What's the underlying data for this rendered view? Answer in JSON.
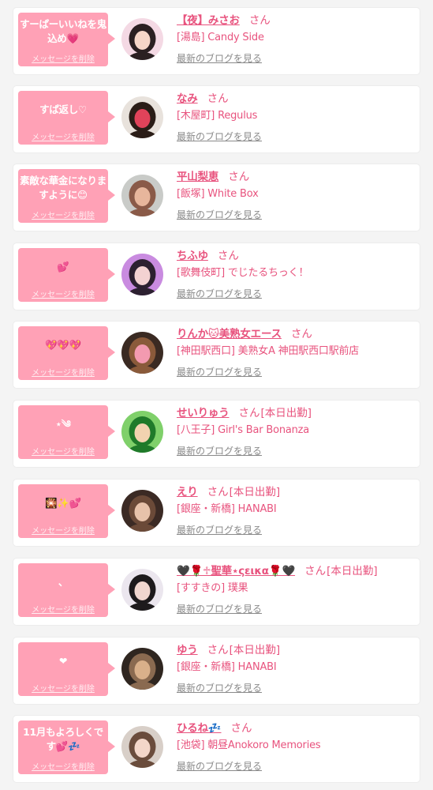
{
  "cards": [
    {
      "message": "すーぱーいいねを鬼込め💗",
      "delete_label": "メッセージを削除",
      "name": "【夜】みさお",
      "san": "さん",
      "status": "",
      "shop": "[湯島] Candy Side",
      "blog_link": "最新のブログを見る",
      "avatar_colors": [
        "#f4d9e4",
        "#2b2022",
        "#f6d6c8"
      ]
    },
    {
      "message": "すぱ返し♡",
      "delete_label": "メッセージを削除",
      "name": "なみ",
      "san": "さん",
      "status": "",
      "shop": "[木屋町] Regulus",
      "blog_link": "最新のブログを見る",
      "avatar_colors": [
        "#e8e2dc",
        "#2a1d17",
        "#e0435a"
      ]
    },
    {
      "message": "素敵な華金になりますように😊",
      "delete_label": "メッセージを削除",
      "name": "平山梨恵",
      "san": "さん",
      "status": "",
      "shop": "[飯塚] White Box",
      "blog_link": "最新のブログを見る",
      "avatar_colors": [
        "#c9cbc8",
        "#8a5a48",
        "#e7b69c"
      ]
    },
    {
      "message": "💕",
      "delete_label": "メッセージを削除",
      "name": "ちふゆ",
      "san": "さん",
      "status": "",
      "shop": "[歌舞伎町] でじたるちっく！",
      "blog_link": "最新のブログを見る",
      "avatar_colors": [
        "#c98be0",
        "#2c2030",
        "#f3d2d2"
      ]
    },
    {
      "message": "💖💖💖",
      "delete_label": "メッセージを削除",
      "name": "りんか🐱美熟女エース",
      "san": "さん",
      "status": "",
      "shop": "[神田駅西口] 美熟女A 神田駅西口駅前店",
      "blog_link": "最新のブログを見る",
      "avatar_colors": [
        "#3a2a22",
        "#8a5a3a",
        "#f39ab0"
      ]
    },
    {
      "message": "⋆༄",
      "delete_label": "メッセージを削除",
      "name": "せいりゅう",
      "san": "さん",
      "status": "[本日出勤]",
      "shop": "[八王子] Girl's Bar Bonanza",
      "blog_link": "最新のブログを見る",
      "avatar_colors": [
        "#7fd06a",
        "#1f7a2a",
        "#f2d3b0"
      ]
    },
    {
      "message": "🎇✨💕",
      "delete_label": "メッセージを削除",
      "name": "えり",
      "san": "さん",
      "status": "[本日出勤]",
      "shop": "[銀座・新橋] HANABI",
      "blog_link": "最新のブログを見る",
      "avatar_colors": [
        "#3b2a24",
        "#6b4a38",
        "#e7c2aa"
      ]
    },
    {
      "message": "、",
      "delete_label": "メッセージを削除",
      "name": "🖤🌹♱聖華⋆ςεικα🌹🖤",
      "san": "さん",
      "status": "[本日出勤]",
      "shop": "[すすきの] 璞果",
      "blog_link": "最新のブログを見る",
      "avatar_colors": [
        "#ebe6ee",
        "#1d1a1c",
        "#f0d6cf"
      ]
    },
    {
      "message": "❤",
      "delete_label": "メッセージを削除",
      "name": "ゆう",
      "san": "さん",
      "status": "[本日出勤]",
      "shop": "[銀座・新橋] HANABI",
      "blog_link": "最新のブログを見る",
      "avatar_colors": [
        "#2f2620",
        "#8a6a50",
        "#d9b08a"
      ]
    },
    {
      "message": "11月もよろしくです💕💤",
      "delete_label": "メッセージを削除",
      "name": "ひるね💤",
      "san": "さん",
      "status": "",
      "shop": "[池袋] 朝昼Anokoro Memories",
      "blog_link": "最新のブログを見る",
      "avatar_colors": [
        "#d8cfc8",
        "#6a4c3c",
        "#f3d6c9"
      ]
    }
  ]
}
